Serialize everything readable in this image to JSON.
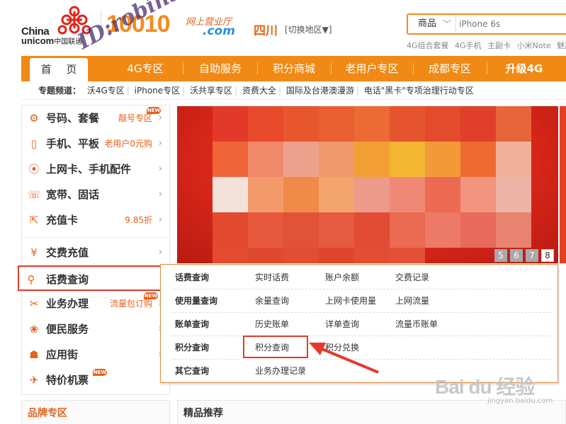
{
  "header": {
    "brand_line1": "China",
    "brand_line2": "unicom",
    "brand_line2_cn": "中国联通",
    "hotline": "10010",
    "site_name": "网上营业厅",
    "site_domain": ".com",
    "region": "四川",
    "switch_region": "[切换地区▼]",
    "watermark": "ID:robin553"
  },
  "search": {
    "category": "商品",
    "placeholder": "iPhone 6s",
    "hot_words": [
      "4G组合套餐",
      "4G手机",
      "主副卡",
      "小米Note",
      "魅族"
    ]
  },
  "nav": {
    "items": [
      {
        "label": "首 页",
        "active": true
      },
      {
        "label": "4G专区"
      },
      {
        "label": "自助服务"
      },
      {
        "label": "积分商城"
      },
      {
        "label": "老用户专区"
      },
      {
        "label": "成都专区"
      },
      {
        "label": "升级4G"
      }
    ]
  },
  "subnav": {
    "label": "专题频道：",
    "items": [
      "沃4G专区",
      "iPhone专区",
      "沃共享专区",
      "资费大全",
      "国际及台港澳漫游",
      "电话\"黑卡\"专项治理行动专区"
    ]
  },
  "sidebar": {
    "items": [
      {
        "label": "号码、套餐",
        "extra": "靓号专区",
        "icon": "gear-icon",
        "new": true
      },
      {
        "label": "手机、平板",
        "extra": "老用户0元购",
        "icon": "phone-icon"
      },
      {
        "label": "上网卡、手机配件",
        "extra": "",
        "icon": "signal-icon"
      },
      {
        "label": "宽带、固话",
        "extra": "",
        "icon": "telephone-icon"
      },
      {
        "label": "充值卡",
        "extra": "9.85折",
        "icon": "recharge-icon"
      },
      {
        "label": "交费充值",
        "extra": "",
        "icon": "yuan-icon"
      },
      {
        "label": "话费查询",
        "extra": "",
        "icon": "search-icon",
        "active": true
      },
      {
        "label": "业务办理",
        "extra": "流量包订购",
        "icon": "tools-icon",
        "new": true
      },
      {
        "label": "便民服务",
        "extra": "",
        "icon": "service-icon"
      },
      {
        "label": "应用街",
        "extra": "",
        "icon": "robot-icon"
      },
      {
        "label": "特价机票",
        "extra": "",
        "icon": "plane-icon",
        "new": true
      }
    ],
    "new_badge": "NEW"
  },
  "banner": {
    "pager": [
      "5",
      "6",
      "7",
      "8"
    ],
    "active_page": "8"
  },
  "query_panel": {
    "rows": [
      {
        "label": "话费查询",
        "links": [
          "实时话费",
          "账户余额",
          "交费记录"
        ]
      },
      {
        "label": "使用量查询",
        "links": [
          "余量查询",
          "上网卡使用量",
          "上网流量"
        ]
      },
      {
        "label": "账单查询",
        "links": [
          "历史账单",
          "详单查询",
          "流量币账单"
        ]
      },
      {
        "label": "积分查询",
        "links": [
          "积分查询",
          "积分兑换"
        ]
      },
      {
        "label": "其它查询",
        "links": [
          "业务办理记录"
        ]
      }
    ]
  },
  "sections": {
    "brand": "品牌专区",
    "recommend": "精品推荐"
  },
  "footer_watermark": {
    "baidu": "Bai du 经验",
    "url": "jingyan.baidu.com"
  },
  "colors": {
    "brand_orange": "#f08a14",
    "accent_red": "#e23b2c",
    "icon_orange": "#e6611c"
  }
}
